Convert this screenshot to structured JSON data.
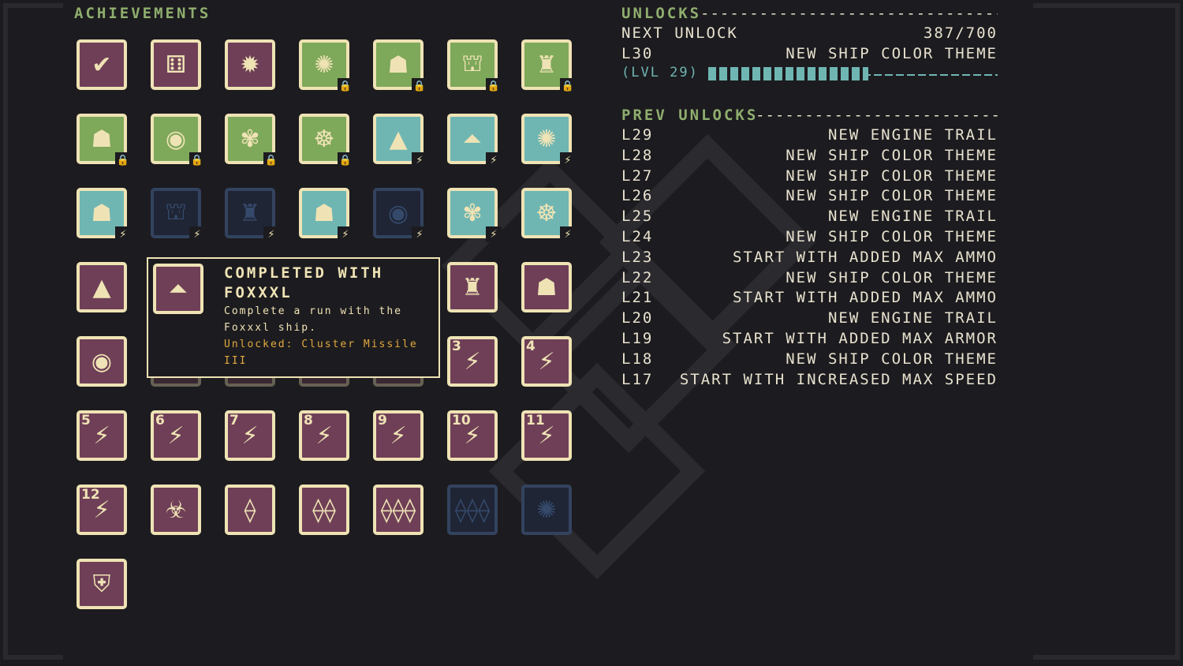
{
  "achievements": {
    "label": "Achievements",
    "tiles": [
      {
        "color": "purple",
        "glyph": "✔",
        "icon": "checkmark-icon"
      },
      {
        "color": "purple",
        "glyph": "⚅",
        "icon": "dice-icon"
      },
      {
        "color": "purple",
        "glyph": "✹",
        "icon": "burst-icon"
      },
      {
        "color": "green",
        "glyph": "✺",
        "icon": "ship-icon",
        "badge": "🔒"
      },
      {
        "color": "green",
        "glyph": "☗",
        "icon": "ship-icon",
        "badge": "🔒"
      },
      {
        "color": "green",
        "glyph": "⛫",
        "icon": "ship-icon",
        "badge": "🔒"
      },
      {
        "color": "green",
        "glyph": "♜",
        "icon": "ship-icon",
        "badge": "🔒"
      },
      {
        "color": "green",
        "glyph": "☗",
        "icon": "ship-icon",
        "badge": "🔒"
      },
      {
        "color": "green",
        "glyph": "◉",
        "icon": "ship-icon",
        "badge": "🔒"
      },
      {
        "color": "green",
        "glyph": "✾",
        "icon": "ship-icon",
        "badge": "🔒"
      },
      {
        "color": "green",
        "glyph": "☸",
        "icon": "ship-icon",
        "badge": "🔒"
      },
      {
        "color": "teal",
        "glyph": "▲",
        "icon": "ship-icon",
        "badge": "⚡"
      },
      {
        "color": "teal",
        "glyph": "⏶",
        "icon": "ship-icon",
        "badge": "⚡"
      },
      {
        "color": "teal",
        "glyph": "✺",
        "icon": "ship-icon",
        "badge": "⚡"
      },
      {
        "color": "teal",
        "glyph": "☗",
        "icon": "ship-icon",
        "badge": "⚡"
      },
      {
        "color": "navy",
        "glyph": "⛫",
        "icon": "ship-icon",
        "badge": "⚡"
      },
      {
        "color": "navy",
        "glyph": "♜",
        "icon": "ship-icon",
        "badge": "⚡"
      },
      {
        "color": "teal",
        "glyph": "☗",
        "icon": "ship-icon",
        "badge": "⚡"
      },
      {
        "color": "navy",
        "glyph": "◉",
        "icon": "ship-icon",
        "badge": "⚡"
      },
      {
        "color": "teal",
        "glyph": "✾",
        "icon": "ship-icon",
        "badge": "⚡"
      },
      {
        "color": "teal",
        "glyph": "☸",
        "icon": "ship-icon",
        "badge": "⚡"
      },
      {
        "color": "purple",
        "glyph": "▲",
        "icon": "ship-icon"
      },
      {
        "color": "purple",
        "glyph": "⏶",
        "icon": "ship-icon",
        "hidden": true
      },
      {
        "color": "purple",
        "glyph": "",
        "icon": "ship-icon",
        "hidden": true
      },
      {
        "color": "purple",
        "glyph": "",
        "icon": "ship-icon",
        "hidden": true
      },
      {
        "color": "purple",
        "glyph": "",
        "icon": "ship-icon",
        "hidden": true
      },
      {
        "color": "purple",
        "glyph": "♜",
        "icon": "ship-icon"
      },
      {
        "color": "purple",
        "glyph": "☗",
        "icon": "ship-icon"
      },
      {
        "color": "purple",
        "glyph": "◉",
        "icon": "ship-icon"
      },
      {
        "color": "purple",
        "glyph": "",
        "icon": "ship-icon",
        "hidden": true
      },
      {
        "color": "purple",
        "glyph": "",
        "icon": "ship-icon",
        "hidden": true
      },
      {
        "color": "purple",
        "glyph": "",
        "icon": "ship-icon",
        "hidden": true
      },
      {
        "color": "purple",
        "glyph": "",
        "icon": "ship-icon",
        "hidden": true
      },
      {
        "color": "purple",
        "glyph": "⚡",
        "icon": "lightning-icon",
        "num": "3"
      },
      {
        "color": "purple",
        "glyph": "⚡",
        "icon": "lightning-icon",
        "num": "4"
      },
      {
        "color": "purple",
        "glyph": "⚡",
        "icon": "lightning-icon",
        "num": "5"
      },
      {
        "color": "purple",
        "glyph": "⚡",
        "icon": "lightning-icon",
        "num": "6"
      },
      {
        "color": "purple",
        "glyph": "⚡",
        "icon": "lightning-icon",
        "num": "7"
      },
      {
        "color": "purple",
        "glyph": "⚡",
        "icon": "lightning-icon",
        "num": "8"
      },
      {
        "color": "purple",
        "glyph": "⚡",
        "icon": "lightning-icon",
        "num": "9"
      },
      {
        "color": "purple",
        "glyph": "⚡",
        "icon": "lightning-icon",
        "num": "10"
      },
      {
        "color": "purple",
        "glyph": "⚡",
        "icon": "lightning-icon",
        "num": "11"
      },
      {
        "color": "purple",
        "glyph": "⚡",
        "icon": "lightning-icon",
        "num": "12"
      },
      {
        "color": "purple",
        "glyph": "☣",
        "icon": "biohazard-icon"
      },
      {
        "color": "purple",
        "glyph": "⟠",
        "icon": "enemy-ship-icon"
      },
      {
        "color": "purple",
        "glyph": "⟠⟠",
        "icon": "enemy-ships-icon"
      },
      {
        "color": "purple",
        "glyph": "⟠⟠⟠",
        "icon": "enemy-fleet-icon"
      },
      {
        "color": "navy",
        "glyph": "⟠⟠⟠",
        "icon": "enemy-fleet-icon"
      },
      {
        "color": "navy",
        "glyph": "✺",
        "icon": "crab-icon"
      },
      {
        "color": "purple",
        "glyph": "⛨",
        "icon": "mask-icon"
      }
    ]
  },
  "tooltip": {
    "title": "Completed with Foxxxl",
    "description": "Complete a run with the Foxxxl ship.",
    "unlocked": "Unlocked: Cluster Missile III",
    "icon_glyph": "⏶"
  },
  "unlocks": {
    "label": "Unlocks",
    "next_label": "Next Unlock",
    "next_progress_text": "387/700",
    "next_level": "L30",
    "next_reward": "New Ship Color Theme",
    "level_text": "(Lvl 29)",
    "progress_fraction": 0.553
  },
  "prev_unlocks": {
    "label": "Prev Unlocks",
    "rows": [
      {
        "level": "L29",
        "reward": "New Engine Trail"
      },
      {
        "level": "L28",
        "reward": "New Ship Color Theme"
      },
      {
        "level": "L27",
        "reward": "New Ship Color Theme"
      },
      {
        "level": "L26",
        "reward": "New Ship Color Theme"
      },
      {
        "level": "L25",
        "reward": "New Engine Trail"
      },
      {
        "level": "L24",
        "reward": "New Ship Color Theme"
      },
      {
        "level": "L23",
        "reward": "Start with added Max Ammo"
      },
      {
        "level": "L22",
        "reward": "New Ship Color Theme"
      },
      {
        "level": "L21",
        "reward": "Start with added Max Ammo"
      },
      {
        "level": "L20",
        "reward": "New Engine Trail"
      },
      {
        "level": "L19",
        "reward": "Start with added Max Armor"
      },
      {
        "level": "L18",
        "reward": "New Ship Color Theme"
      },
      {
        "level": "L17",
        "reward": "Start with increased max speed"
      }
    ]
  },
  "colors": {
    "background": "#1c1b1f",
    "accent_green": "#8fae6e",
    "accent_teal": "#6fb6b3",
    "accent_gold": "#e0aa3e",
    "cream": "#efe3b5",
    "tile_purple": "#6f3f57",
    "tile_green": "#7ea85a",
    "tile_navy": "#1f2535"
  }
}
